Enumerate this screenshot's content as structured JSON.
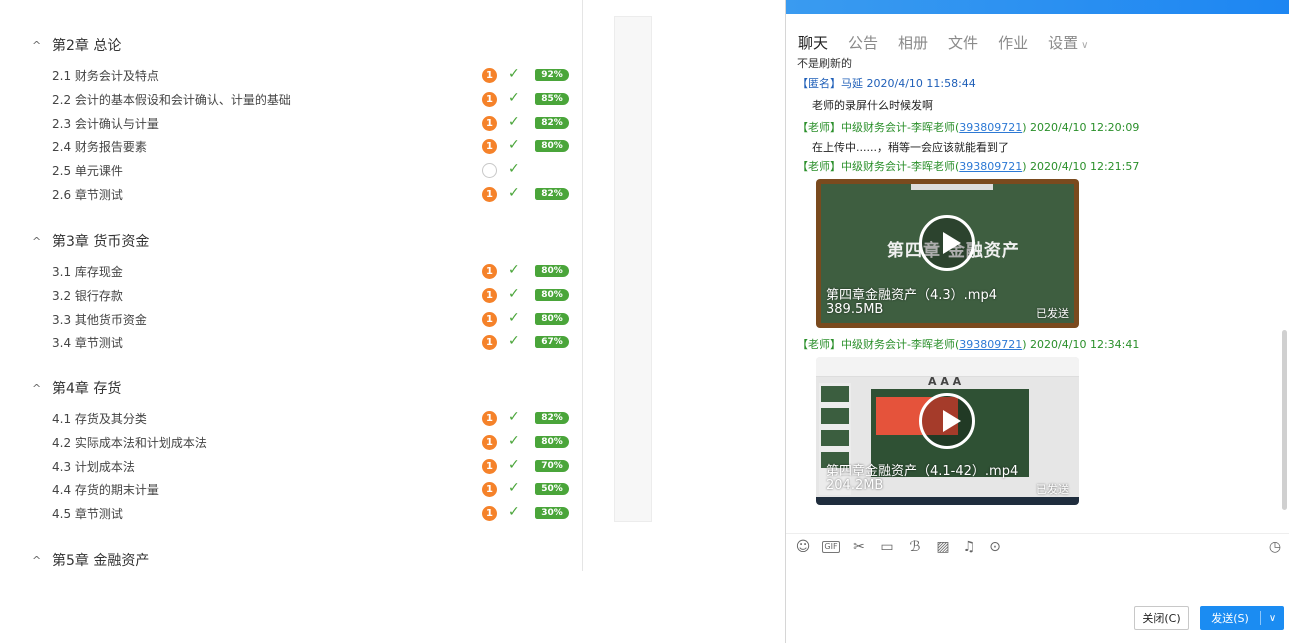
{
  "outline": {
    "chapters": [
      {
        "title": "第2章 总论",
        "lessons": [
          {
            "label": "2.1  财务会计及特点",
            "badge": "1",
            "progress": "92%"
          },
          {
            "label": "2.2  会计的基本假设和会计确认、计量的基础",
            "badge": "1",
            "progress": "85%"
          },
          {
            "label": "2.3  会计确认与计量",
            "badge": "1",
            "progress": "82%"
          },
          {
            "label": "2.4  财务报告要素",
            "badge": "1",
            "progress": "80%"
          },
          {
            "label": "2.5  单元课件",
            "badge": "",
            "progress": ""
          },
          {
            "label": "2.6  章节测试",
            "badge": "1",
            "progress": "82%"
          }
        ]
      },
      {
        "title": "第3章 货币资金",
        "lessons": [
          {
            "label": "3.1  库存现金",
            "badge": "1",
            "progress": "80%"
          },
          {
            "label": "3.2  银行存款",
            "badge": "1",
            "progress": "80%"
          },
          {
            "label": "3.3  其他货币资金",
            "badge": "1",
            "progress": "80%"
          },
          {
            "label": "3.4  章节测试",
            "badge": "1",
            "progress": "67%"
          }
        ]
      },
      {
        "title": "第4章 存货",
        "lessons": [
          {
            "label": "4.1  存货及其分类",
            "badge": "1",
            "progress": "82%"
          },
          {
            "label": "4.2  实际成本法和计划成本法",
            "badge": "1",
            "progress": "80%"
          },
          {
            "label": "4.3  计划成本法",
            "badge": "1",
            "progress": "70%"
          },
          {
            "label": "4.4  存货的期末计量",
            "badge": "1",
            "progress": "50%"
          },
          {
            "label": "4.5  章节测试",
            "badge": "1",
            "progress": "30%"
          }
        ]
      },
      {
        "title": "第5章 金融资产",
        "lessons": []
      }
    ]
  },
  "chat": {
    "tabs": [
      "聊天",
      "公告",
      "相册",
      "文件",
      "作业",
      "设置"
    ],
    "active_tab": "聊天",
    "cut_text": "不是刷新的",
    "messages": [
      {
        "prefix": "【匿名】马延",
        "qq": "",
        "time": "2020/4/10 11:58:44",
        "body": "老师的录屏什么时候发啊"
      },
      {
        "prefix": "【老师】中级财务会计-李晖老师(",
        "qq": "393809721",
        "time": ") 2020/4/10 12:20:09",
        "body": "在上传中......，稍等一会应该就能看到了"
      },
      {
        "prefix": "【老师】中级财务会计-李晖老师(",
        "qq": "393809721",
        "time": ") 2020/4/10 12:21:57",
        "body": ""
      },
      {
        "prefix": "【老师】中级财务会计-李晖老师(",
        "qq": "393809721",
        "time": ") 2020/4/10 12:34:41",
        "body": ""
      }
    ],
    "videos": [
      {
        "board_text": "第四章  金融资产",
        "name": "第四章金融资产（4.3）.mp4",
        "size": "389.5MB",
        "status": "已发送"
      },
      {
        "name": "第四章金融资产（4.1-42）.mp4",
        "size": "204.2MB",
        "status": "已发送",
        "slide_text": "A A A"
      }
    ],
    "toolbar_icons": [
      "smiley-icon",
      "gif-icon",
      "scissors-icon",
      "folder-icon",
      "magic-font-icon",
      "image-icon",
      "bell-icon",
      "more-icon",
      "history-icon"
    ],
    "gif_label": "GIF",
    "close_label": "关闭(C)",
    "send_label": "发送(S)"
  }
}
